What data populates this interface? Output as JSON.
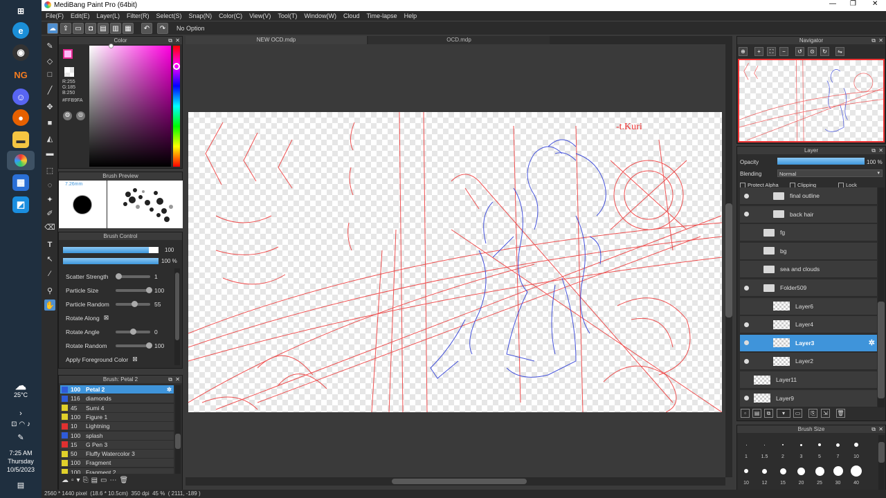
{
  "app": {
    "title": "MediBang Paint Pro (64bit)"
  },
  "menu": [
    "File(F)",
    "Edit(E)",
    "Layer(L)",
    "Filter(R)",
    "Select(S)",
    "Snap(N)",
    "Color(C)",
    "View(V)",
    "Tool(T)",
    "Window(W)",
    "Cloud",
    "Time-lapse",
    "Help"
  ],
  "toolbar": {
    "option_text": "No Option"
  },
  "tabs": [
    "NEW OCD.mdp",
    "OCD.mdp"
  ],
  "color_panel": {
    "title": "Color",
    "rgb": [
      "R:255",
      "G:185",
      "B:250"
    ],
    "hex": "#FFB9FA",
    "fg_color": "#ffb9fa",
    "accent": "#3f94da"
  },
  "brush_preview": {
    "title": "Brush Preview",
    "size": "7.26mm"
  },
  "brush_control": {
    "title": "Brush Control",
    "size_value": "100",
    "opacity_value": "100 %",
    "params": [
      {
        "label": "Scatter Strength",
        "value": "1",
        "level": 0.05
      },
      {
        "label": "Particle Size",
        "value": "100",
        "level": 1.0
      },
      {
        "label": "Particle Random",
        "value": "55",
        "level": 0.55
      },
      {
        "label": "Rotate Along",
        "value": "",
        "level": null
      },
      {
        "label": "Rotate Angle",
        "value": "0",
        "level": 0.5
      },
      {
        "label": "Rotate Random",
        "value": "100",
        "level": 1.0
      },
      {
        "label": "Apply Foreground Color",
        "value": "",
        "level": null
      }
    ]
  },
  "brush_list": {
    "title": "Brush: Petal 2",
    "items": [
      {
        "size": "100",
        "name": "Petal 2",
        "color": "#2f5bd8",
        "selected": true
      },
      {
        "size": "116",
        "name": "diamonds",
        "color": "#2f5bd8"
      },
      {
        "size": "45",
        "name": "Sumi 4",
        "color": "#e0d02a"
      },
      {
        "size": "100",
        "name": "Figure 1",
        "color": "#e0d02a"
      },
      {
        "size": "10",
        "name": "Lightning",
        "color": "#e03030"
      },
      {
        "size": "100",
        "name": "splash",
        "color": "#2f5bd8"
      },
      {
        "size": "15",
        "name": "G Pen 3",
        "color": "#e03030"
      },
      {
        "size": "50",
        "name": "Fluffy Watercolor 3",
        "color": "#e0d02a"
      },
      {
        "size": "100",
        "name": "Fragment",
        "color": "#e0d02a"
      },
      {
        "size": "100",
        "name": "Fragment 2",
        "color": "#e0d02a"
      }
    ]
  },
  "navigator": {
    "title": "Navigator"
  },
  "layer_panel": {
    "title": "Layer",
    "opacity_label": "Opacity",
    "opacity_value": "100 %",
    "opacity_level": 1.0,
    "blending_label": "Blending",
    "blending_value": "Normal",
    "protect_alpha": "Protect Alpha",
    "clipping": "Clipping",
    "lock": "Lock",
    "layers": [
      {
        "name": "final outline",
        "type": "folder",
        "visible": true,
        "indent": 2
      },
      {
        "name": "back hair",
        "type": "folder",
        "visible": true,
        "indent": 2
      },
      {
        "name": "fg",
        "type": "folder",
        "visible": false,
        "indent": 1
      },
      {
        "name": "bg",
        "type": "folder",
        "visible": false,
        "indent": 1
      },
      {
        "name": "sea and clouds",
        "type": "folder",
        "visible": false,
        "indent": 1
      },
      {
        "name": "Folder509",
        "type": "folder",
        "visible": true,
        "indent": 1
      },
      {
        "name": "Layer6",
        "type": "layer",
        "visible": false,
        "indent": 2
      },
      {
        "name": "Layer4",
        "type": "layer",
        "visible": true,
        "indent": 2
      },
      {
        "name": "Layer3",
        "type": "layer",
        "visible": true,
        "indent": 2,
        "selected": true
      },
      {
        "name": "Layer2",
        "type": "layer",
        "visible": true,
        "indent": 2
      },
      {
        "name": "Layer11",
        "type": "layer",
        "visible": false,
        "indent": 0
      },
      {
        "name": "Layer9",
        "type": "layer",
        "visible": true,
        "indent": 0
      }
    ]
  },
  "brush_size": {
    "title": "Brush Size",
    "row1": [
      "1",
      "1.5",
      "2",
      "3",
      "5",
      "7",
      "10"
    ],
    "row2": [
      "10",
      "12",
      "15",
      "20",
      "25",
      "30",
      "40"
    ]
  },
  "canvas": {
    "signature": "-t.Kuri"
  },
  "status": {
    "text": "2560 * 1440 pixel  (18.6 * 10.5cm)  350 dpi  45 %  ( 2111, -189 )"
  },
  "taskbar": {
    "temperature": "25°C",
    "time": "7:25 AM",
    "day": "Thursday",
    "date": "10/5/2023"
  }
}
